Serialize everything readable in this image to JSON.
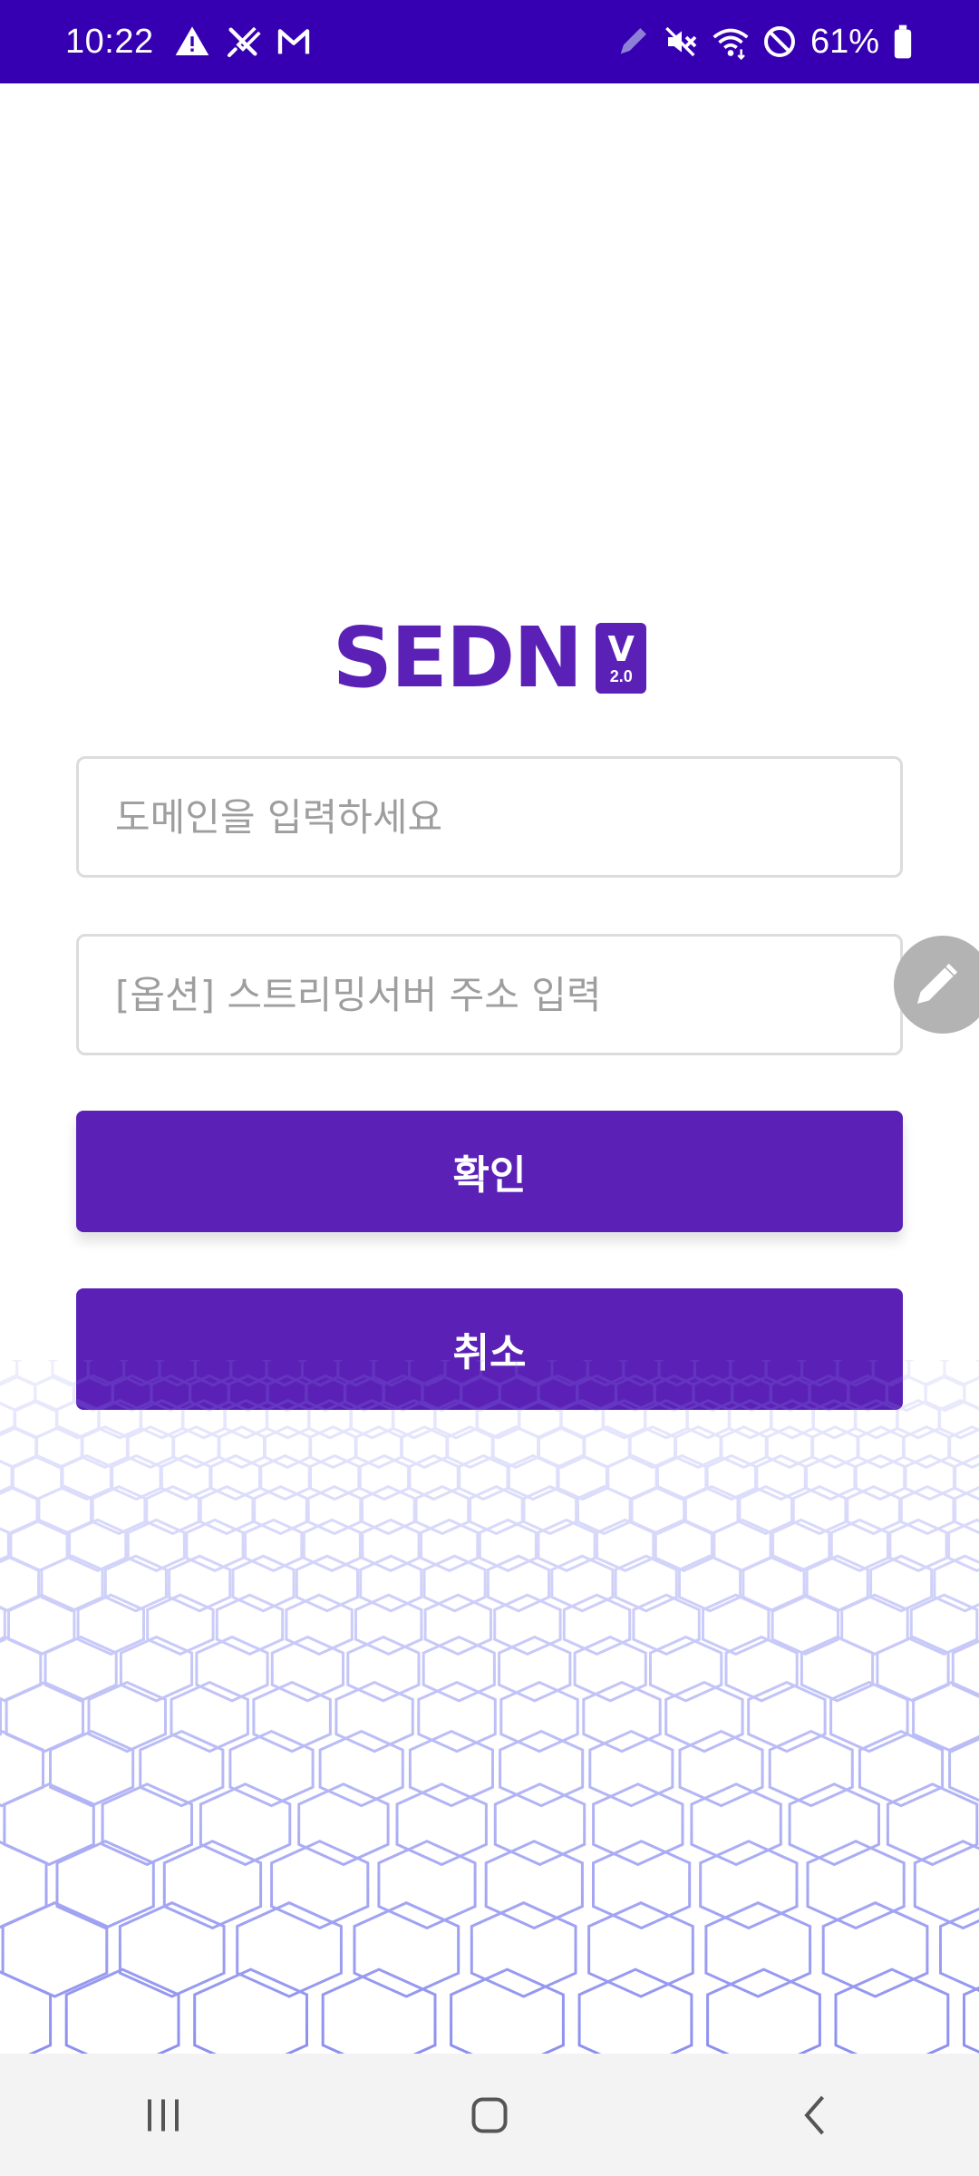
{
  "status_bar": {
    "time": "10:22",
    "battery_percent": "61%",
    "background_color": "#3600b2",
    "left_icons": [
      "warning-icon",
      "signal-off-icon",
      "gmail-icon"
    ],
    "right_icons": [
      "pen-icon",
      "vibrate-mute-icon",
      "wifi-icon",
      "do-not-disturb-icon",
      "battery-icon"
    ]
  },
  "logo": {
    "text": "SEDN",
    "badge_letter": "V",
    "badge_version": "2.0",
    "color": "#5b21b6"
  },
  "form": {
    "domain_placeholder": "도메인을 입력하세요",
    "domain_value": "",
    "server_placeholder": "[옵션] 스트리밍서버 주소 입력",
    "server_value": "",
    "confirm_label": "확인",
    "cancel_label": "취소",
    "button_color": "#5b21b6"
  },
  "floating_button": {
    "icon": "pencil-icon"
  },
  "nav_bar": {
    "icons": [
      "recent-apps-icon",
      "home-icon",
      "back-icon"
    ]
  }
}
